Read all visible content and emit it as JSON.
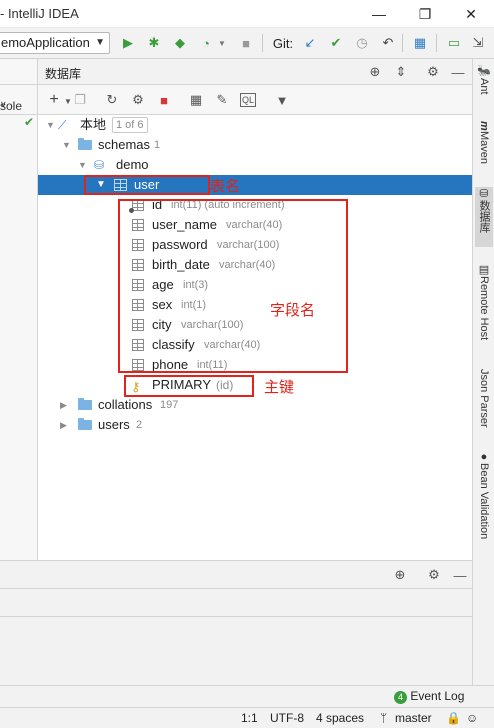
{
  "window": {
    "title": "- IntelliJ IDEA",
    "controls": {
      "minimize": "—",
      "restore": "❐",
      "close": "✕"
    }
  },
  "toolbar": {
    "run_config": "emoApplication",
    "git_label": "Git:",
    "icons": [
      "run-icon",
      "debug-icon",
      "coverage-icon",
      "profile-icon",
      "stop-icon",
      "git-update-icon",
      "git-commit-icon",
      "git-history-icon",
      "git-rollback-icon",
      "project-structure-icon",
      "terminal-icon",
      "maximize-icon"
    ]
  },
  "left_panel": {
    "dropdown_label": "sole"
  },
  "db_panel": {
    "title": "数据库",
    "tree": {
      "root": {
        "label": "本地",
        "page": "1 of 6"
      },
      "schemas": {
        "label": "schemas",
        "count": "1"
      },
      "schema": {
        "label": "demo"
      },
      "table": {
        "label": "user"
      },
      "columns": [
        {
          "name": "id",
          "type": "int(11) (auto increment)",
          "key": true
        },
        {
          "name": "user_name",
          "type": "varchar(40)",
          "key": false
        },
        {
          "name": "password",
          "type": "varchar(100)",
          "key": false
        },
        {
          "name": "birth_date",
          "type": "varchar(40)",
          "key": false
        },
        {
          "name": "age",
          "type": "int(3)",
          "key": false
        },
        {
          "name": "sex",
          "type": "int(1)",
          "key": false
        },
        {
          "name": "city",
          "type": "varchar(100)",
          "key": false
        },
        {
          "name": "classify",
          "type": "varchar(40)",
          "key": false
        },
        {
          "name": "phone",
          "type": "int(11)",
          "key": false
        }
      ],
      "primary_key": {
        "label": "PRIMARY",
        "cols": "(id)"
      },
      "collations": {
        "label": "collations",
        "count": "197"
      },
      "users": {
        "label": "users",
        "count": "2"
      }
    }
  },
  "annotations": {
    "table_name": "表名",
    "field_name": "字段名",
    "primary_key": "主键"
  },
  "annotation_color": "#e0241b",
  "selection_color": "#2675bf",
  "right_tabs": [
    "Ant",
    "Maven",
    "数据库",
    "Remote Host",
    "Json Parser",
    "Bean Validation"
  ],
  "event_log": "Event Log",
  "event_log_count": "4",
  "status": {
    "position": "1:1",
    "encoding": "UTF-8",
    "indent": "4 spaces",
    "branch": "master"
  }
}
